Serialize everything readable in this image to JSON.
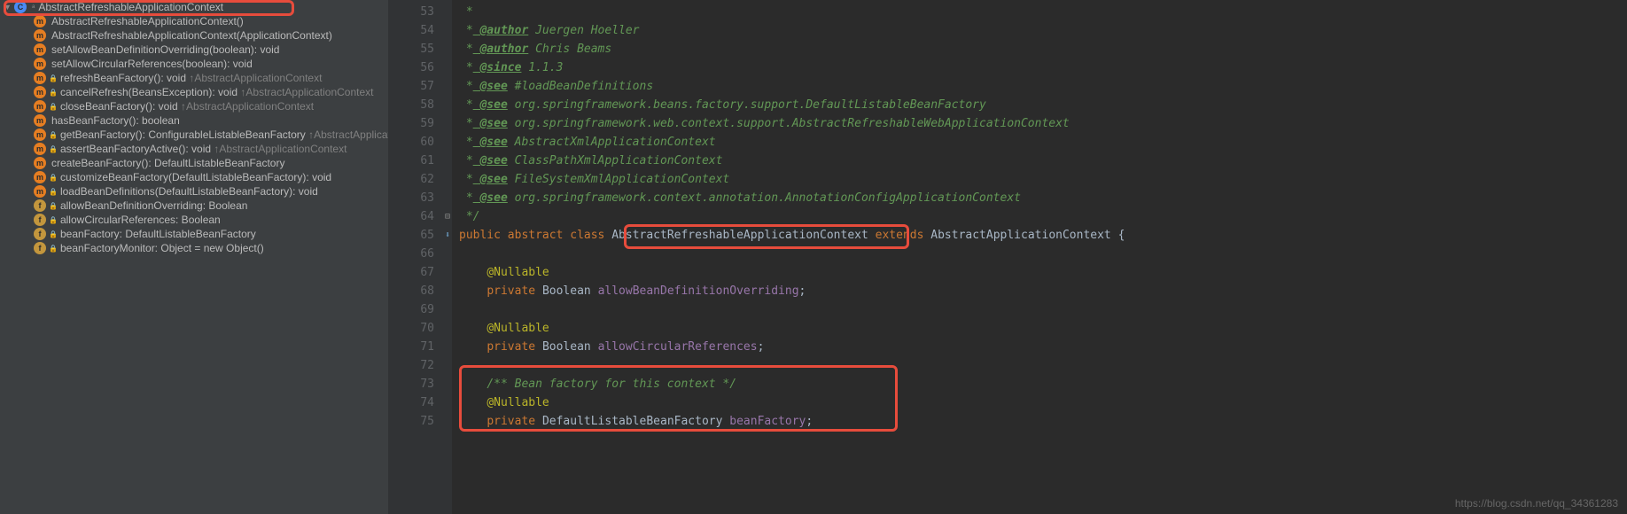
{
  "structure": {
    "root": "AbstractRefreshableApplicationContext",
    "items": [
      {
        "icon": "m",
        "text": "AbstractRefreshableApplicationContext()",
        "override": ""
      },
      {
        "icon": "m",
        "text": "AbstractRefreshableApplicationContext(ApplicationContext)",
        "override": ""
      },
      {
        "icon": "m",
        "text": "setAllowBeanDefinitionOverriding(boolean): void",
        "override": ""
      },
      {
        "icon": "m",
        "text": "setAllowCircularReferences(boolean): void",
        "override": ""
      },
      {
        "icon": "m",
        "text": "refreshBeanFactory(): void",
        "override": " ↑AbstractApplicationContext",
        "lock": true
      },
      {
        "icon": "m",
        "text": "cancelRefresh(BeansException): void",
        "override": " ↑AbstractApplicationContext",
        "lock": true
      },
      {
        "icon": "m",
        "text": "closeBeanFactory(): void",
        "override": " ↑AbstractApplicationContext",
        "lock": true
      },
      {
        "icon": "m",
        "text": "hasBeanFactory(): boolean",
        "override": ""
      },
      {
        "icon": "m",
        "text": "getBeanFactory(): ConfigurableListableBeanFactory",
        "override": " ↑AbstractApplication",
        "lock": true
      },
      {
        "icon": "m",
        "text": "assertBeanFactoryActive(): void",
        "override": " ↑AbstractApplicationContext",
        "lock": true
      },
      {
        "icon": "m",
        "text": "createBeanFactory(): DefaultListableBeanFactory",
        "override": ""
      },
      {
        "icon": "m",
        "text": "customizeBeanFactory(DefaultListableBeanFactory): void",
        "override": "",
        "lock": true
      },
      {
        "icon": "m",
        "text": "loadBeanDefinitions(DefaultListableBeanFactory): void",
        "override": "",
        "lock": true
      },
      {
        "icon": "fy",
        "text": "allowBeanDefinitionOverriding: Boolean",
        "override": "",
        "lock": true
      },
      {
        "icon": "fy",
        "text": "allowCircularReferences: Boolean",
        "override": "",
        "lock": true
      },
      {
        "icon": "fy",
        "text": "beanFactory: DefaultListableBeanFactory",
        "override": "",
        "lock": true
      },
      {
        "icon": "fy",
        "text": "beanFactoryMonitor: Object = new Object()",
        "override": "",
        "lock": true
      }
    ]
  },
  "lines": {
    "start": 53,
    "end": 75
  },
  "code": {
    "l53": " *",
    "l54_tag": " @author",
    "l54_rest": " Juergen Hoeller",
    "l55_tag": " @author",
    "l55_rest": " Chris Beams",
    "l56_tag": " @since",
    "l56_rest": " 1.1.3",
    "l57_tag": " @see",
    "l57_rest": " #loadBeanDefinitions",
    "l58_tag": " @see",
    "l58_rest": " org.springframework.beans.factory.support.DefaultListableBeanFactory",
    "l59_tag": " @see",
    "l59_rest": " org.springframework.web.context.support.AbstractRefreshableWebApplicationContext",
    "l60_tag": " @see",
    "l60_rest": " AbstractXmlApplicationContext",
    "l61_tag": " @see",
    "l61_rest": " ClassPathXmlApplicationContext",
    "l62_tag": " @see",
    "l62_rest": " FileSystemXmlApplicationContext",
    "l63_tag": " @see",
    "l63_rest": " org.springframework.context.annotation.AnnotationConfigApplicationContext",
    "l64": " */",
    "l65_kw1": "public ",
    "l65_kw2": "abstract ",
    "l65_kw3": "class ",
    "l65_name": "AbstractRefreshableApplicationContext",
    "l65_kw4": " extends ",
    "l65_parent": "AbstractApplicationContext {",
    "l67": "@Nullable",
    "l68_kw": "private ",
    "l68_type": "Boolean ",
    "l68_field": "allowBeanDefinitionOverriding",
    "l68_end": ";",
    "l70": "@Nullable",
    "l71_kw": "private ",
    "l71_type": "Boolean ",
    "l71_field": "allowCircularReferences",
    "l71_end": ";",
    "l73": "/** Bean factory for this context */",
    "l74": "@Nullable",
    "l75_kw": "private ",
    "l75_type": "DefaultListableBeanFactory ",
    "l75_field": "beanFactory",
    "l75_end": ";"
  },
  "watermark": "https://blog.csdn.net/qq_34361283"
}
